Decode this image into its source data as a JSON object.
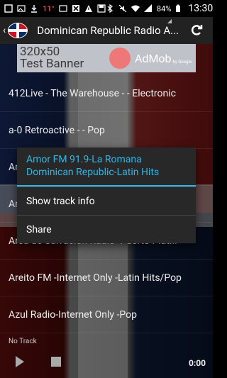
{
  "status_bar": {
    "temperature": "11°",
    "battery": "84%",
    "time": "13:30"
  },
  "action_bar": {
    "title": "Dominican Republic Radio A..."
  },
  "ad": {
    "label_line1": "320x50",
    "label_line2": "Test Banner",
    "brand": "AdMob",
    "by": "by Google"
  },
  "stations": [
    {
      "label": "412Live - The Warehouse - - Electronic"
    },
    {
      "label": "a-0 Retroactive - - Pop"
    },
    {
      "label": "Ar"
    },
    {
      "label": "Ar"
    },
    {
      "label": "Arca de Salvacion Radio -Puerto Plat..."
    },
    {
      "label": "Areito FM -Internet Only -Latin Hits/Pop"
    },
    {
      "label": "Azul Radio-Internet Only -Pop"
    }
  ],
  "player": {
    "now_playing": "No Track",
    "time": "0:00"
  },
  "context_menu": {
    "title_line1": "Amor FM 91.9-La Romana",
    "title_line2": "Dominican Republic-Latin Hits",
    "items": [
      {
        "label": "Show track info"
      },
      {
        "label": "Share"
      }
    ]
  }
}
